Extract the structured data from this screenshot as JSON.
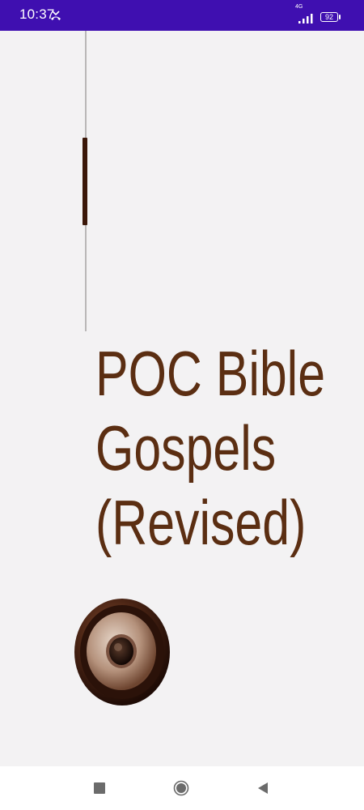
{
  "status_bar": {
    "time": "10:37",
    "network_type": "4G",
    "battery_level": "92",
    "icons": [
      "missed-call-icon",
      "signal-icon",
      "battery-icon"
    ],
    "background_color": "#3f0fb0"
  },
  "content": {
    "title_lines": [
      "POC Bible",
      "Gospels",
      "(Revised)"
    ],
    "title_color": "#5b2e12",
    "scroll_thumb_color": "#3b1708",
    "speaker_icon": "speaker-icon"
  },
  "nav_bar": {
    "buttons": [
      "recents-button",
      "home-button",
      "back-button"
    ]
  }
}
